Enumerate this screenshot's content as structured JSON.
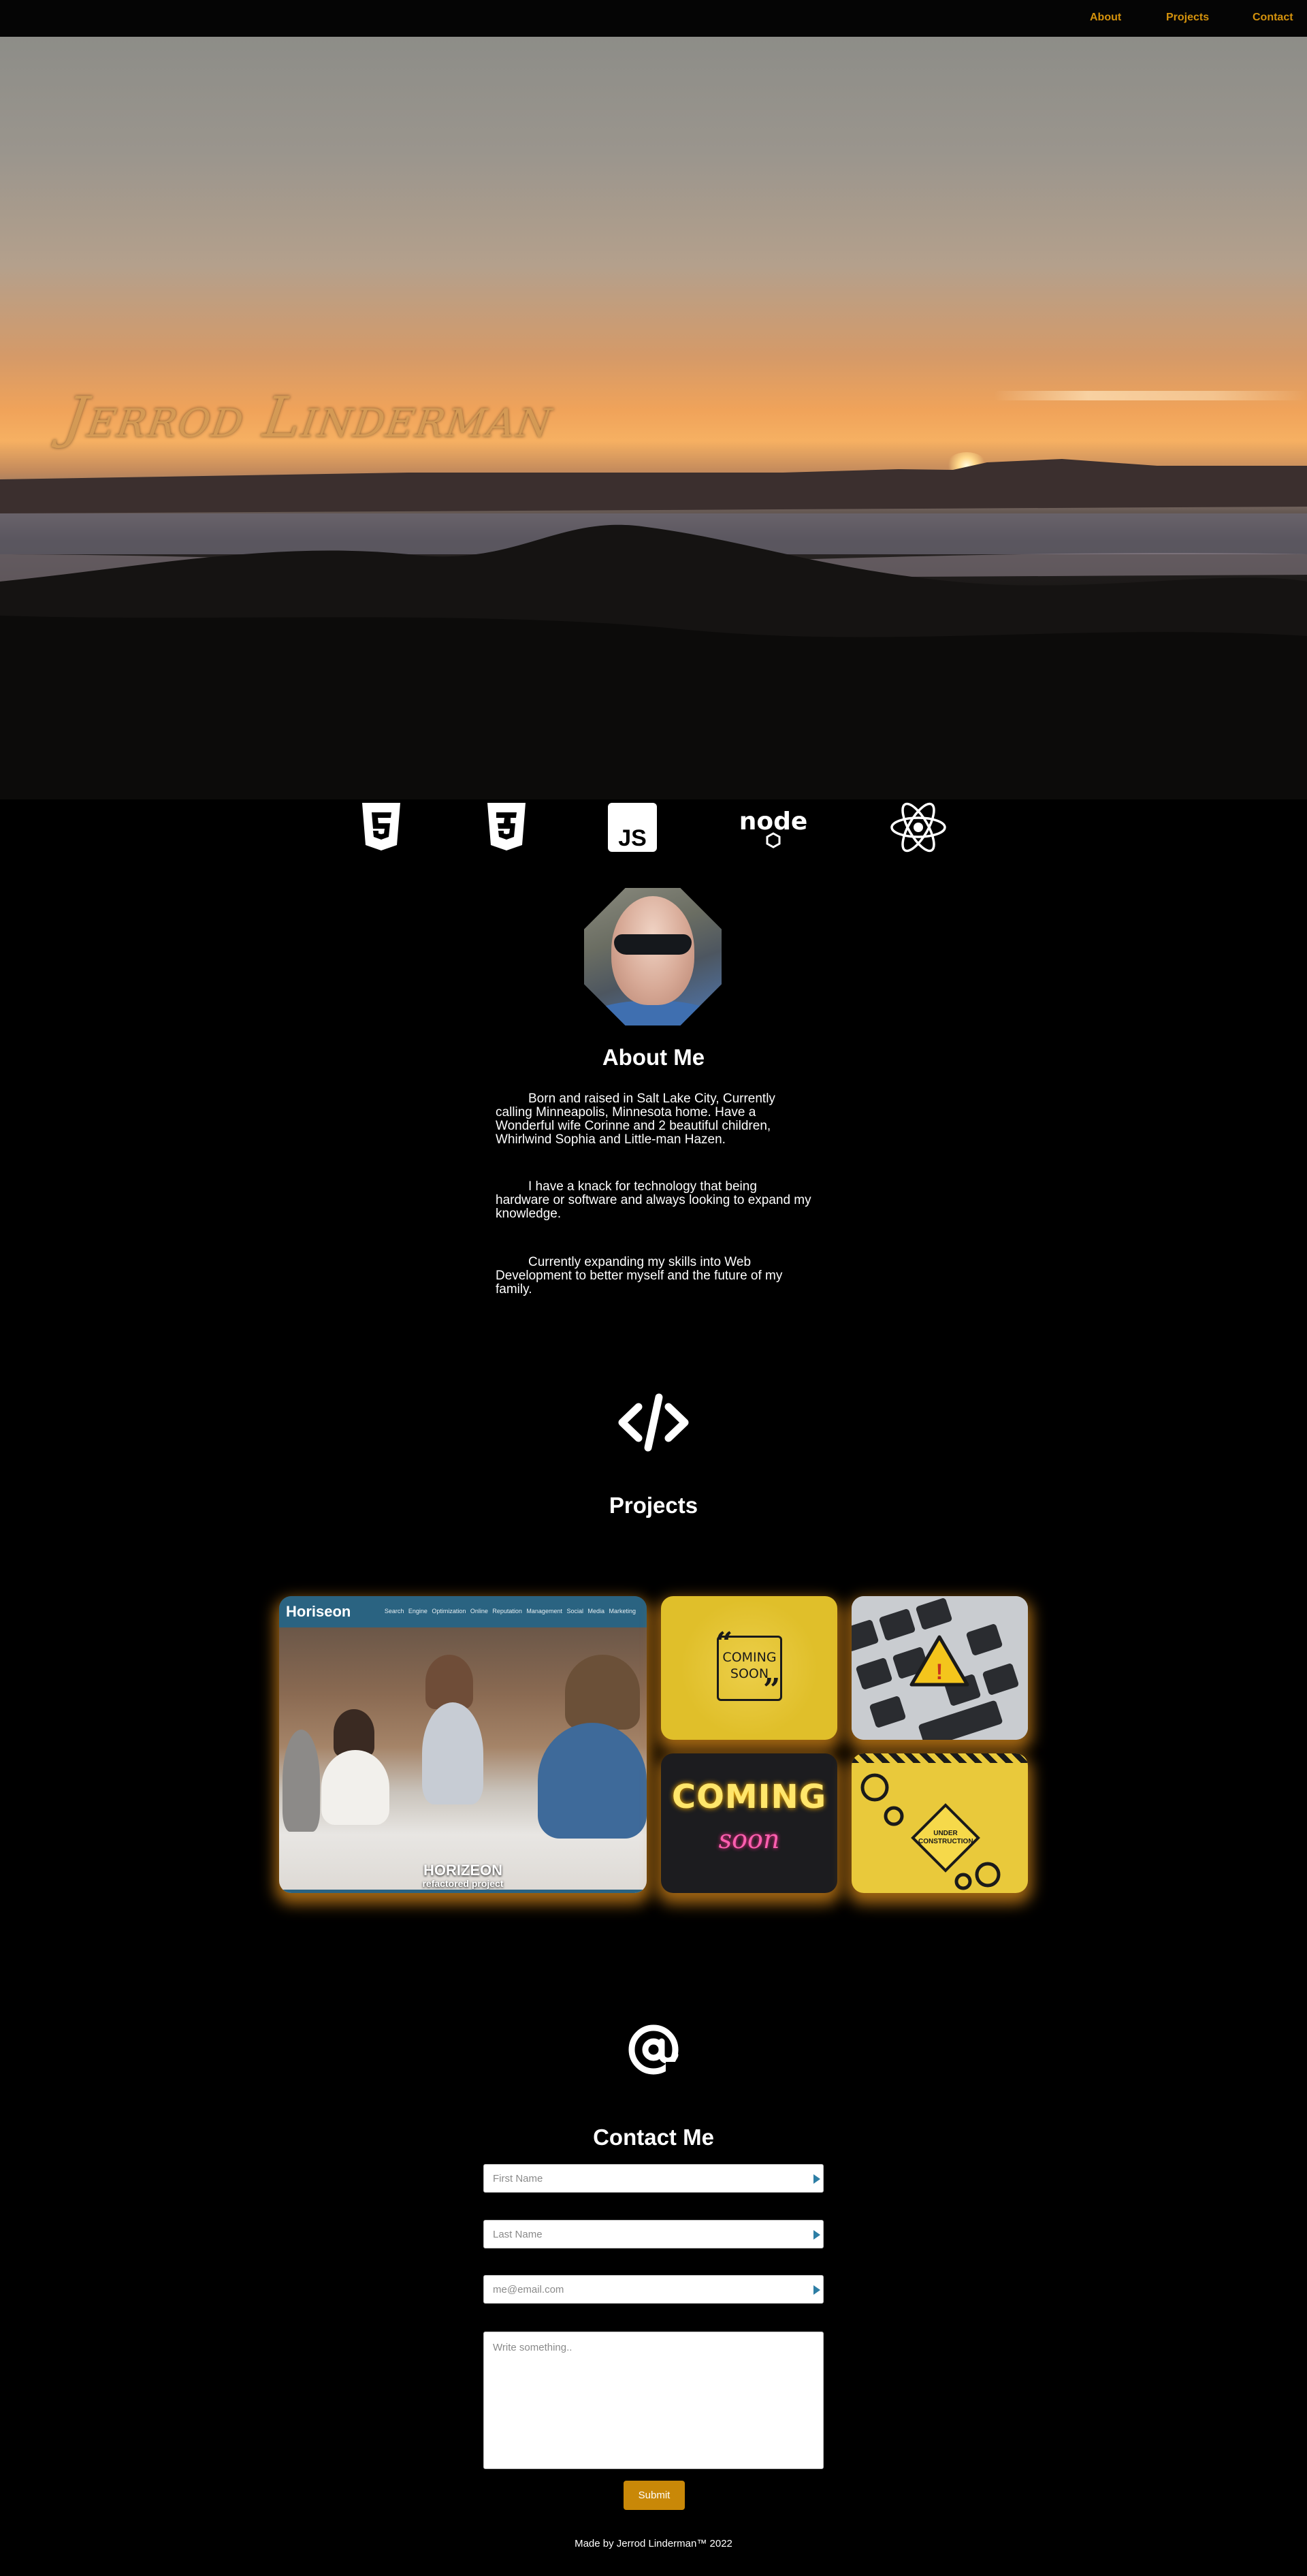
{
  "nav": {
    "items": [
      "About",
      "Projects",
      "Contact"
    ]
  },
  "hero": {
    "name": "Jerrod Linderman"
  },
  "tech_icons": [
    "html5-icon",
    "css3-icon",
    "javascript-icon",
    "nodejs-icon",
    "react-icon"
  ],
  "tech_labels": {
    "js": "JS",
    "node": "node"
  },
  "about": {
    "heading": "About Me",
    "paragraphs": [
      "Born and raised in Salt Lake City, Currently calling Minneapolis, Minnesota home. Have a Wonderful wife Corinne and 2 beautiful children, Whirlwind Sophia and Little-man Hazen.",
      "I have a knack for technology that being hardware or software and always looking to expand my knowledge.",
      "Currently expanding my skills into Web Development to better myself and the future of my family."
    ]
  },
  "projects": {
    "heading": "Projects",
    "horiseon": {
      "brand": "Horiseon",
      "links": "Search Engine Optimization   Online Reputation Management   Social Media Marketing",
      "caption_title": "HORIZEON",
      "caption_sub": "refactored project"
    },
    "coming_soon_1": "COMING SOON",
    "coming_soon_2": {
      "line1": "COMING",
      "line2": "soon"
    },
    "under_construction": "UNDER CONSTRUCTION"
  },
  "contact": {
    "heading": "Contact Me",
    "first_name_placeholder": "First Name",
    "last_name_placeholder": "Last Name",
    "email_placeholder": "me@email.com",
    "message_placeholder": "Write something..",
    "submit_label": "Submit"
  },
  "footer": {
    "text": "Made by Jerrod Linderman™ 2022"
  },
  "colors": {
    "accent": "#d4920c",
    "background": "#000000",
    "glow": "#d68719"
  }
}
